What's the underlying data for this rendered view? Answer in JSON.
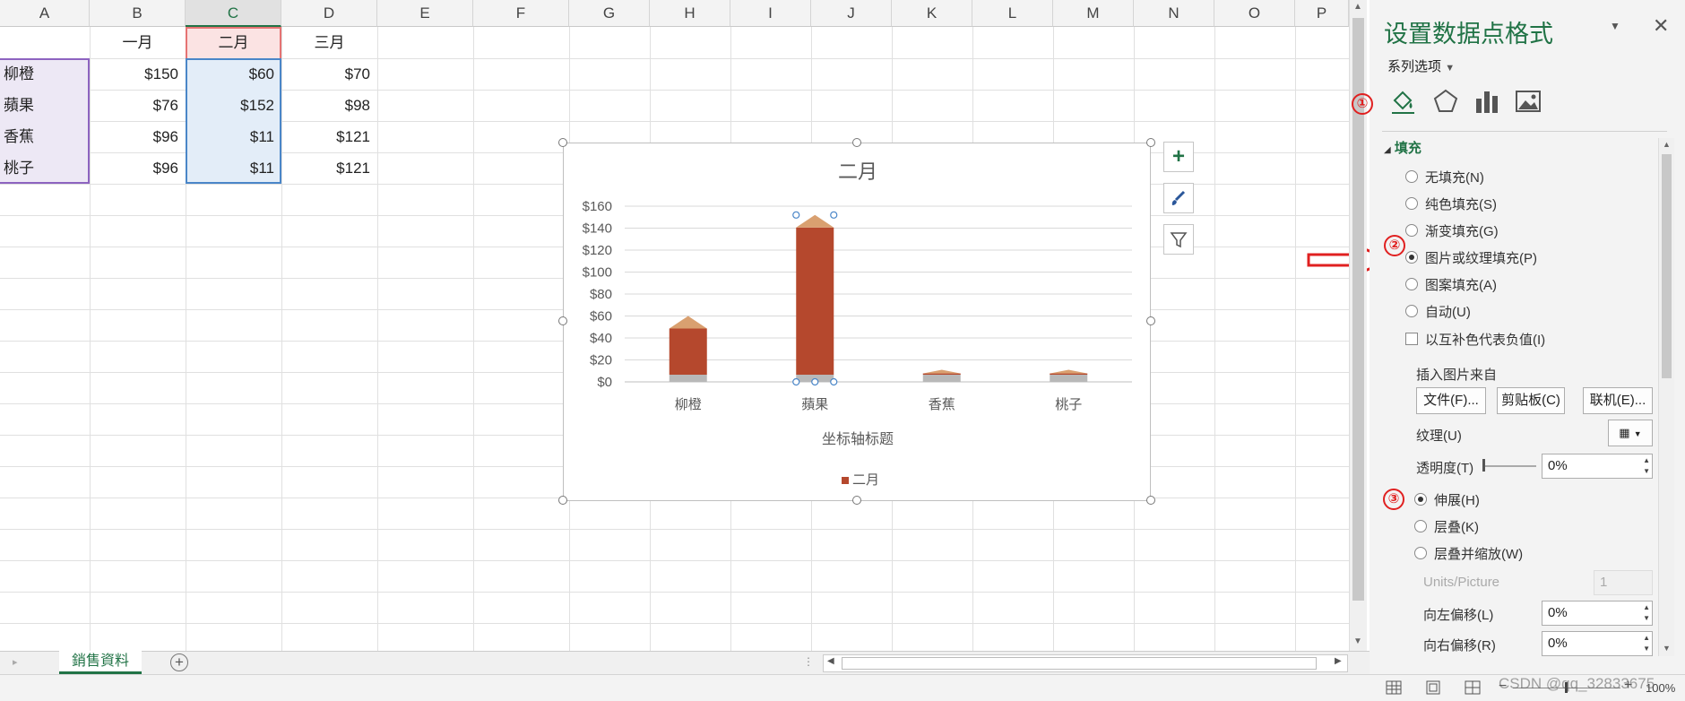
{
  "columns": [
    "A",
    "B",
    "C",
    "D",
    "E",
    "F",
    "G",
    "H",
    "I",
    "J",
    "K",
    "L",
    "M",
    "N",
    "O",
    "P"
  ],
  "header_row": {
    "b": "一月",
    "c": "二月",
    "d": "三月"
  },
  "rows": [
    {
      "a": "柳橙",
      "b": "$150",
      "c": "$60",
      "d": "$70"
    },
    {
      "a": "蘋果",
      "b": "$76",
      "c": "$152",
      "d": "$98"
    },
    {
      "a": "香蕉",
      "b": "$96",
      "c": "$11",
      "d": "$121"
    },
    {
      "a": "桃子",
      "b": "$96",
      "c": "$11",
      "d": "$121"
    }
  ],
  "chart_data": {
    "type": "bar",
    "title": "二月",
    "categories": [
      "柳橙",
      "蘋果",
      "香蕉",
      "桃子"
    ],
    "series": [
      {
        "name": "二月",
        "values": [
          60,
          152,
          11,
          11
        ]
      }
    ],
    "xlabel": "坐标轴标题",
    "ylabel": "",
    "ylim": [
      0,
      160
    ],
    "yticks": [
      "$160",
      "$140",
      "$120",
      "$100",
      "$80",
      "$60",
      "$40",
      "$20",
      "$0"
    ],
    "grid": true,
    "legend": "bottom"
  },
  "chart_tools": {
    "add": "+",
    "style": "brush-icon",
    "filter": "filter-icon"
  },
  "sheet": {
    "tab": "銷售資料",
    "add": "+"
  },
  "panel": {
    "title": "设置数据点格式",
    "series_options": "系列选项",
    "section": "填充",
    "fill_options": [
      {
        "label": "无填充(N)",
        "on": false
      },
      {
        "label": "纯色填充(S)",
        "on": false
      },
      {
        "label": "渐变填充(G)",
        "on": false
      },
      {
        "label": "图片或纹理填充(P)",
        "on": true
      },
      {
        "label": "图案填充(A)",
        "on": false
      },
      {
        "label": "自动(U)",
        "on": false
      }
    ],
    "invert_label": "以互补色代表负值(I)",
    "insert_from": "插入图片来自",
    "btn_file": "文件(F)...",
    "btn_clipboard": "剪贴板(C)",
    "btn_online": "联机(E)...",
    "texture_label": "纹理(U)",
    "transparency_label": "透明度(T)",
    "transparency_value": "0%",
    "stretch_options": [
      {
        "label": "伸展(H)",
        "on": true
      },
      {
        "label": "层叠(K)",
        "on": false
      },
      {
        "label": "层叠并缩放(W)",
        "on": false
      }
    ],
    "units_label": "Units/Picture",
    "units_value": "1",
    "offset_left_label": "向左偏移(L)",
    "offset_left_value": "0%",
    "offset_right_label": "向右偏移(R)",
    "offset_right_value": "0%",
    "markers": [
      "①",
      "②",
      "③"
    ]
  },
  "status": {
    "zoom": "100%",
    "watermark": "CSDN @qq_32833675"
  }
}
